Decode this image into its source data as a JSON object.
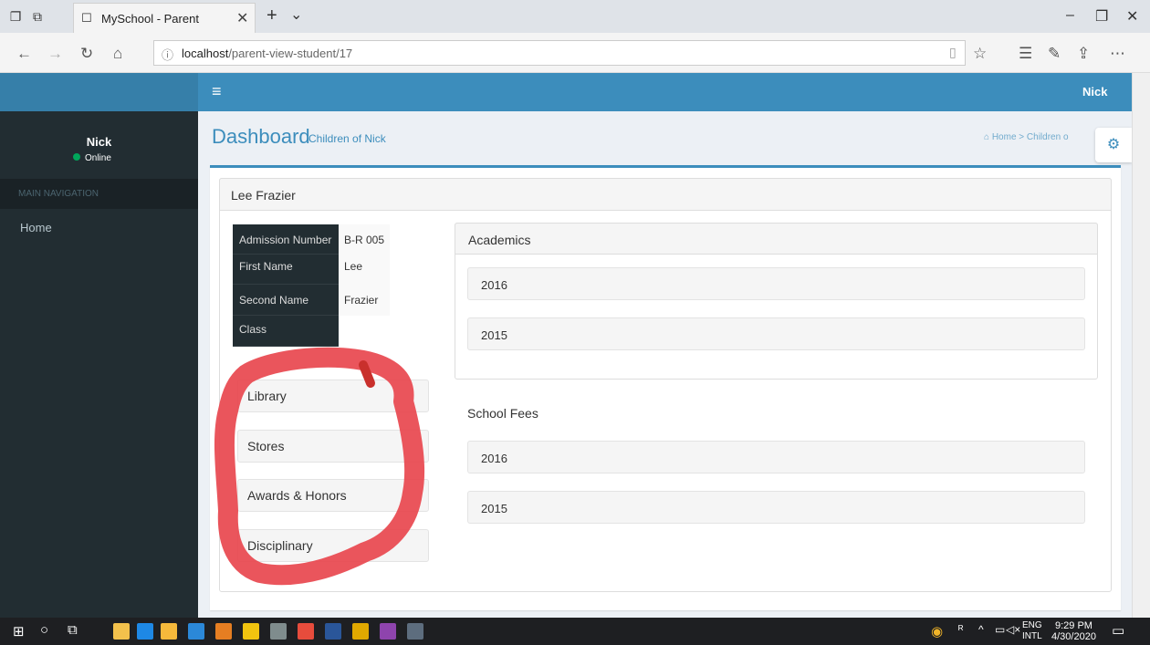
{
  "browser": {
    "tab_title": "MySchool - Parent",
    "url_host": "localhost",
    "url_path": "/parent-view-student/17"
  },
  "header": {
    "username": "Nick"
  },
  "sidebar": {
    "user_name": "Nick",
    "status": "Online",
    "section_label": "MAIN NAVIGATION",
    "items": [
      {
        "label": "Home"
      }
    ]
  },
  "page": {
    "title": "Dashboard",
    "subtitle": "Children of Nick",
    "breadcrumb_home": "Home",
    "breadcrumb_current": "Children o"
  },
  "student": {
    "name": "Lee Frazier",
    "fields": [
      {
        "label": "Admission Number",
        "value": "B-R 005"
      },
      {
        "label": "First Name",
        "value": "Lee"
      },
      {
        "label": "Second Name",
        "value": "Frazier"
      },
      {
        "label": "Class",
        "value": ""
      }
    ]
  },
  "sections": [
    {
      "label": "Library"
    },
    {
      "label": "Stores"
    },
    {
      "label": "Awards & Honors"
    },
    {
      "label": "Disciplinary"
    }
  ],
  "academics": {
    "title": "Academics",
    "years": [
      "2016",
      "2015"
    ]
  },
  "fees": {
    "title": "School Fees",
    "years": [
      "2016",
      "2015"
    ]
  },
  "taskbar": {
    "lang_1": "ENG",
    "lang_2": "INTL",
    "time": "9:29 PM",
    "date": "4/30/2020"
  },
  "colors": {
    "primary": "#3c8dbc",
    "sidebar": "#222d32",
    "annotation": "#e8474e"
  }
}
